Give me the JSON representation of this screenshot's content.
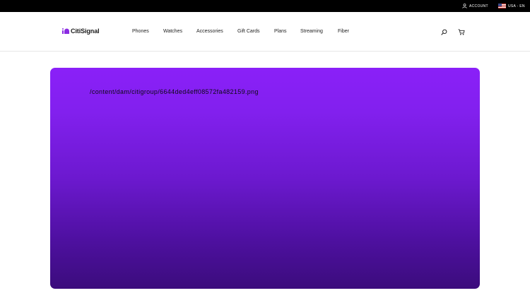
{
  "topbar": {
    "account_label": "ACCOUNT",
    "locale_label": "USA - EN",
    "account_icon": "user-icon",
    "locale_icon": "us-flag-icon"
  },
  "header": {
    "brand": "CitiSignal",
    "brand_color": "#8a2be2",
    "nav": [
      {
        "label": "Phones"
      },
      {
        "label": "Watches"
      },
      {
        "label": "Accessories"
      },
      {
        "label": "Gift Cards"
      },
      {
        "label": "Plans"
      },
      {
        "label": "Streaming"
      },
      {
        "label": "Fiber"
      }
    ],
    "icons": {
      "search": "search-icon",
      "cart": "cart-icon"
    }
  },
  "hero": {
    "image_path": "/content/dam/citigroup/6644ded4eff08572fa482159.png",
    "gradient_top": "#8a20f8",
    "gradient_bottom": "#3b0c7c"
  }
}
